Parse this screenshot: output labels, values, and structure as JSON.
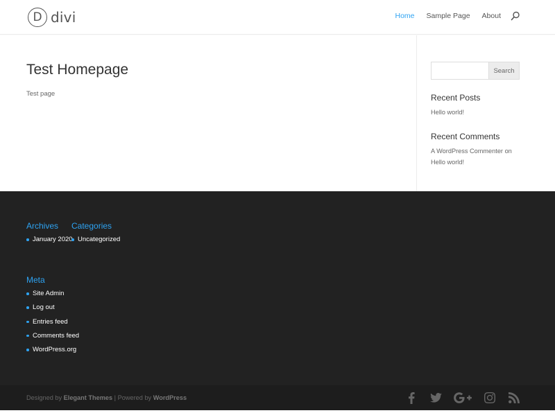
{
  "header": {
    "logo_letter": "D",
    "logo_text": "divi",
    "nav": [
      {
        "label": "Home"
      },
      {
        "label": "Sample Page"
      },
      {
        "label": "About"
      }
    ]
  },
  "main": {
    "title": "Test Homepage",
    "body": "Test page"
  },
  "sidebar": {
    "search_placeholder": "",
    "search_button": "Search",
    "recent_posts_title": "Recent Posts",
    "recent_posts": [
      "Hello world!"
    ],
    "recent_comments_title": "Recent Comments",
    "recent_comment_author": "A WordPress Commenter",
    "recent_comment_on": "on",
    "recent_comment_post": "Hello world!"
  },
  "footer": {
    "archives_title": "Archives",
    "archives": [
      "January 2020"
    ],
    "categories_title": "Categories",
    "categories": [
      "Uncategorized"
    ],
    "meta_title": "Meta",
    "meta": [
      "Site Admin",
      "Log out",
      "Entries feed",
      "Comments feed",
      "WordPress.org"
    ]
  },
  "bottom": {
    "designed_by": "Designed by",
    "elegant": "Elegant Themes",
    "separator": "|",
    "powered_by": "Powered by",
    "wordpress": "WordPress"
  },
  "colors": {
    "accent": "#2ea3f2",
    "footer_bg": "#222222",
    "bottom_bar_bg": "#1d1d1d"
  },
  "icons": [
    "search-icon",
    "facebook-icon",
    "twitter-icon",
    "google-plus-icon",
    "instagram-icon",
    "rss-icon"
  ]
}
